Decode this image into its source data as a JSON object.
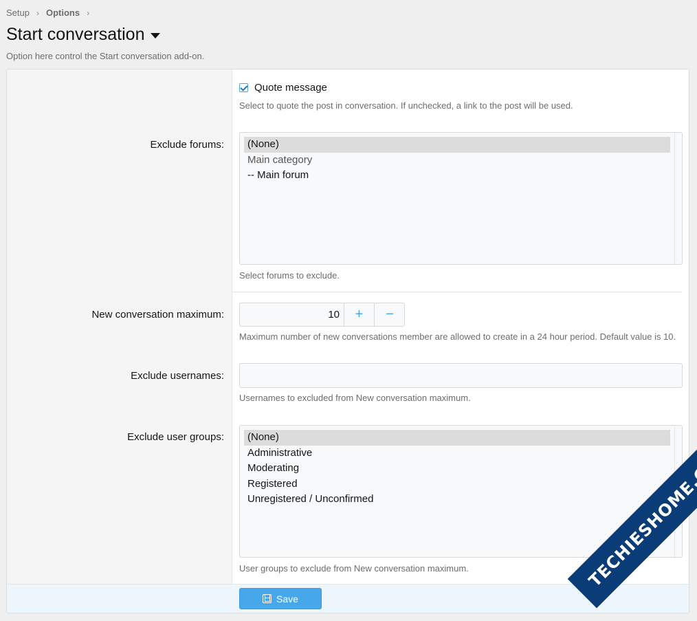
{
  "breadcrumb": {
    "items": [
      "Setup",
      "Options"
    ]
  },
  "page": {
    "title": "Start conversation",
    "description": "Option here control the Start conversation add-on."
  },
  "options": {
    "quote_message": {
      "label": "Quote message",
      "checked": true,
      "help": "Select to quote the post in conversation. If unchecked, a link to the post will be used."
    },
    "exclude_forums": {
      "label": "Exclude forums:",
      "options": [
        "(None)",
        "Main category",
        "-- Main forum"
      ],
      "selected": "(None)",
      "help": "Select forums to exclude."
    },
    "new_conversation_maximum": {
      "label": "New conversation maximum:",
      "value": "10",
      "plus": "+",
      "minus": "−",
      "help": "Maximum number of new conversations member are allowed to create in a 24 hour period. Default value is 10."
    },
    "exclude_usernames": {
      "label": "Exclude usernames:",
      "value": "",
      "help": "Usernames to excluded from New conversation maximum."
    },
    "exclude_user_groups": {
      "label": "Exclude user groups:",
      "options": [
        "(None)",
        "Administrative",
        "Moderating",
        "Registered",
        "Unregistered / Unconfirmed"
      ],
      "selected": "(None)",
      "help": "User groups to exclude from New conversation maximum."
    }
  },
  "footer": {
    "save_label": "Save"
  },
  "watermark": {
    "text": "TECHIESHOME.COM"
  }
}
